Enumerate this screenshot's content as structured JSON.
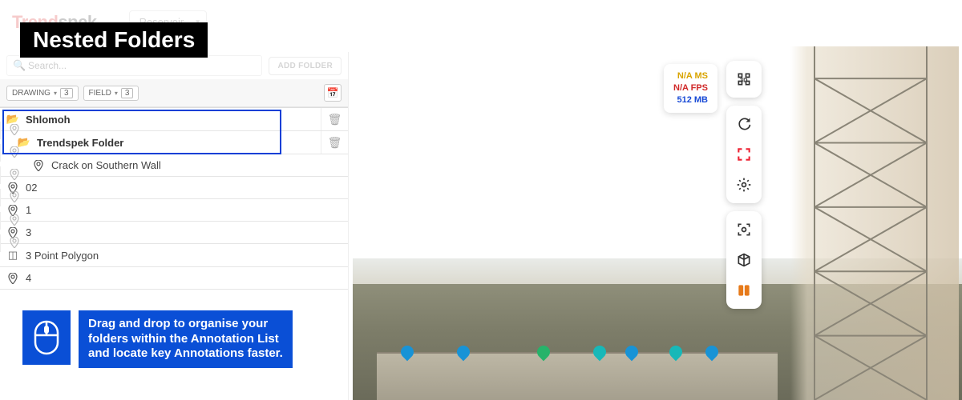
{
  "banner": {
    "title": "Nested Folders"
  },
  "header": {
    "logo_prefix": "Trend",
    "logo_suffix": "spek",
    "project_label": "Reservoir"
  },
  "sidebar": {
    "search_placeholder": "Search...",
    "add_folder_label": "ADD FOLDER",
    "filters": {
      "drawing_label": "DRAWING",
      "drawing_count": "3",
      "field_label": "FIELD",
      "field_count": "3"
    },
    "rows": [
      {
        "icon": "folder-open",
        "label": "Shlomoh",
        "trail": "trash",
        "bold": true,
        "indent": 0
      },
      {
        "icon": "folder-open",
        "label": "Trendspek Folder",
        "trail": "trash",
        "bold": true,
        "indent": 1
      },
      {
        "icon": "map-pin",
        "label": "Crack on Southern Wall",
        "trail": "pin",
        "bold": false,
        "indent": 2
      },
      {
        "icon": "map-pin",
        "label": "02",
        "trail": "pin",
        "bold": false,
        "indent": 0
      },
      {
        "icon": "map-pin",
        "label": "1",
        "trail": "pin",
        "bold": false,
        "indent": 0
      },
      {
        "icon": "map-pin",
        "label": "3",
        "trail": "pin",
        "bold": false,
        "indent": 0
      },
      {
        "icon": "polygon",
        "label": "3 Point Polygon",
        "trail": "pin",
        "bold": false,
        "indent": 0
      },
      {
        "icon": "map-pin",
        "label": "4",
        "trail": "pin",
        "bold": false,
        "indent": 0
      }
    ]
  },
  "tip": {
    "line1": "Drag and drop to organise your",
    "line2": "folders within the Annotation List",
    "line3": "and locate key Annotations faster."
  },
  "stats": {
    "ms": "N/A MS",
    "fps": "N/A FPS",
    "mb": "512 MB"
  },
  "tools": {
    "g1": [
      "3d-icon"
    ],
    "g2": [
      "refresh-icon",
      "fullscreen-icon",
      "gear-icon"
    ],
    "g3": [
      "focus-icon",
      "cube-icon",
      "grid-icon"
    ]
  }
}
